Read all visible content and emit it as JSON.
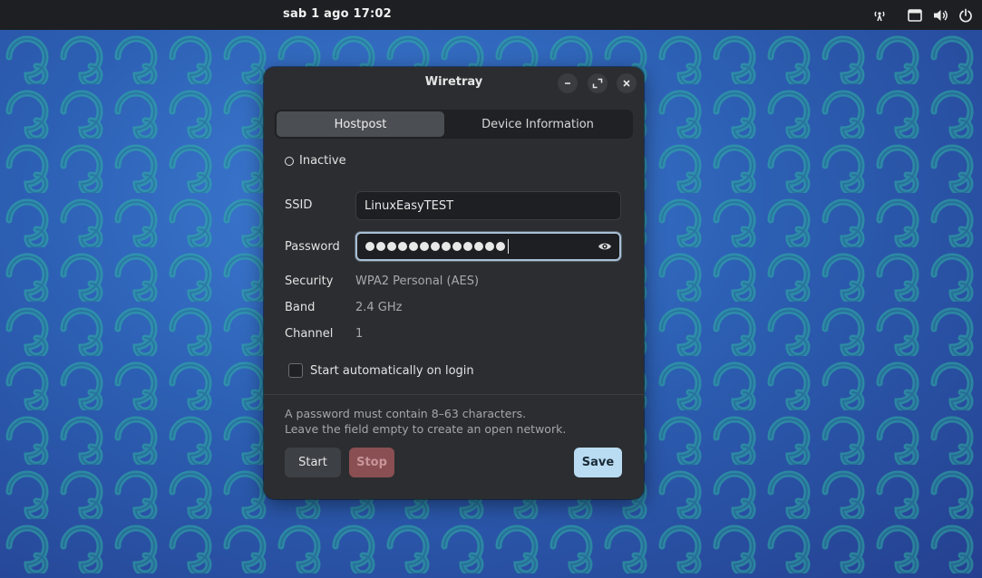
{
  "topbar": {
    "clock": "sab 1 ago  17:02",
    "icons": [
      "hotspot-icon",
      "window-icon",
      "volume-icon",
      "power-icon"
    ]
  },
  "window": {
    "title": "Wiretray",
    "controls": [
      "minimize-icon",
      "maximize-icon",
      "close-icon"
    ],
    "tabs": [
      {
        "label": "Hostpost",
        "active": true
      },
      {
        "label": "Device Information",
        "active": false
      }
    ],
    "status": "Inactive",
    "fields": {
      "ssid_label": "SSID",
      "ssid_value": "LinuxEasyTEST",
      "password_label": "Password",
      "password_length": 13
    },
    "info": {
      "security_label": "Security",
      "security_value": "WPA2 Personal (AES)",
      "band_label": "Band",
      "band_value": "2.4 GHz",
      "channel_label": "Channel",
      "channel_value": "1"
    },
    "autostart_label": "Start automatically on login",
    "autostart_checked": false,
    "hint_line1": "A password must contain 8–63 characters.",
    "hint_line2": "Leave the field empty to create an open network.",
    "buttons": {
      "start": "Start",
      "stop": "Stop",
      "save": "Save"
    }
  },
  "colors": {
    "accent": "#b9dcf2",
    "destructive": "#8a4f52",
    "window_bg": "#2b2d30",
    "topbar_bg": "#1d1f22"
  }
}
